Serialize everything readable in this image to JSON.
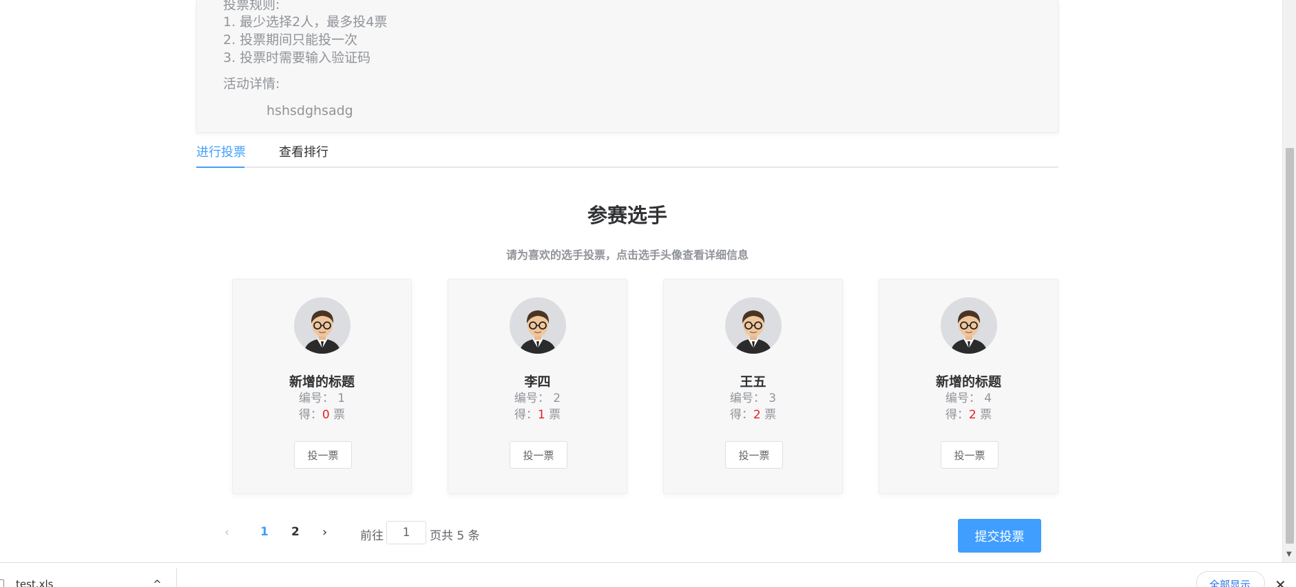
{
  "activity": {
    "rules_title": "投票规则:",
    "rules": [
      "1. 最少选择2人，最多投4票",
      "2. 投票期间只能投一次",
      "3. 投票时需要输入验证码"
    ],
    "detail_label": "活动详情:",
    "detail_text": "hshsdghsadg"
  },
  "tabs": [
    {
      "label": "进行投票",
      "active": true
    },
    {
      "label": "查看排行",
      "active": false
    }
  ],
  "heading": "参赛选手",
  "subheading": "请为喜欢的选手投票，点击选手头像查看详细信息",
  "candidates": [
    {
      "name": "新增的标题",
      "num_label": "编号：",
      "num": "1",
      "votes_prefix": "得：",
      "votes": "0",
      "votes_suffix": "票",
      "vote_label": "投一票"
    },
    {
      "name": "李四",
      "num_label": "编号：",
      "num": "2",
      "votes_prefix": "得：",
      "votes": "1",
      "votes_suffix": "票",
      "vote_label": "投一票"
    },
    {
      "name": "王五",
      "num_label": "编号：",
      "num": "3",
      "votes_prefix": "得：",
      "votes": "2",
      "votes_suffix": "票",
      "vote_label": "投一票"
    },
    {
      "name": "新增的标题",
      "num_label": "编号：",
      "num": "4",
      "votes_prefix": "得：",
      "votes": "2",
      "votes_suffix": "票",
      "vote_label": "投一票"
    }
  ],
  "pagination": {
    "prev": "‹",
    "pages": [
      "1",
      "2"
    ],
    "current": "1",
    "next": "›",
    "goto_label": "前往",
    "goto_value": "1",
    "total_text": "页共 5 条"
  },
  "submit_label": "提交投票",
  "download_bar": {
    "file_name": "test.xls",
    "chevron": "^",
    "show_all": "全部显示",
    "close": "✕"
  },
  "colors": {
    "accent": "#409eff",
    "vote_count": "#e02020"
  }
}
